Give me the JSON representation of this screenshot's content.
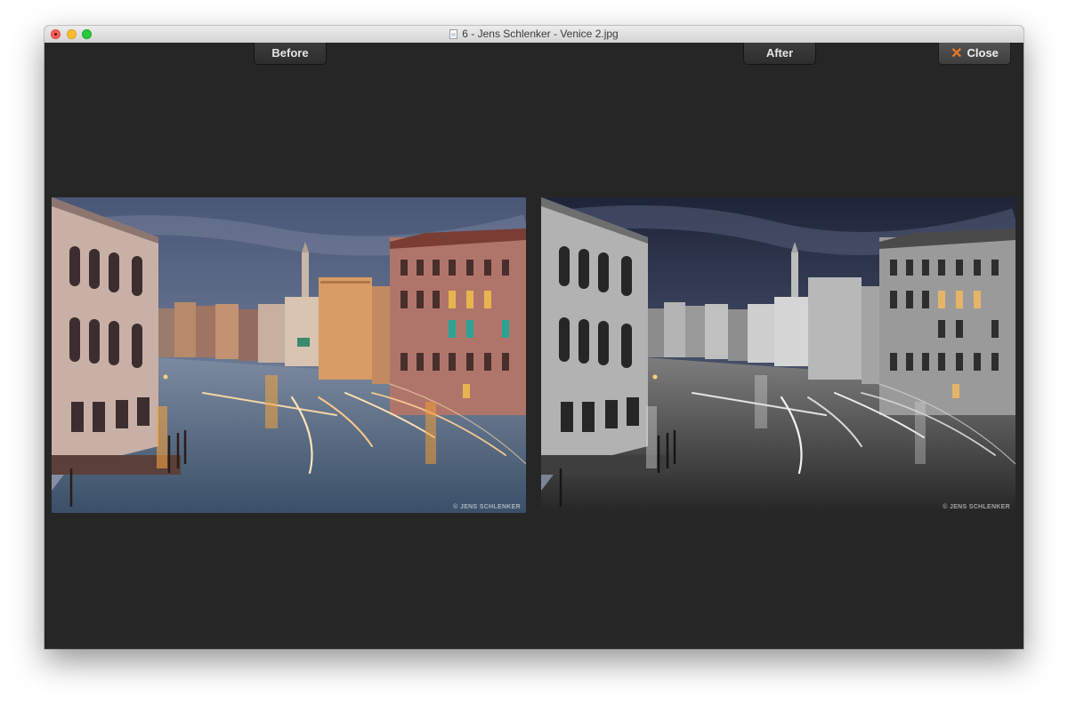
{
  "window": {
    "title": "6 - Jens Schlenker - Venice 2.jpg"
  },
  "toolbar": {
    "before_label": "Before",
    "after_label": "After",
    "close_label": "Close"
  },
  "photos": {
    "before": {
      "subject": "Venice Grand Canal at dusk, color",
      "watermark": "© JENS SCHLENKER"
    },
    "after": {
      "subject": "Venice Grand Canal at dusk, black and white with blue sky",
      "watermark": "© JENS SCHLENKER"
    }
  },
  "colors": {
    "background": "#262626",
    "close_accent": "#f07822"
  }
}
